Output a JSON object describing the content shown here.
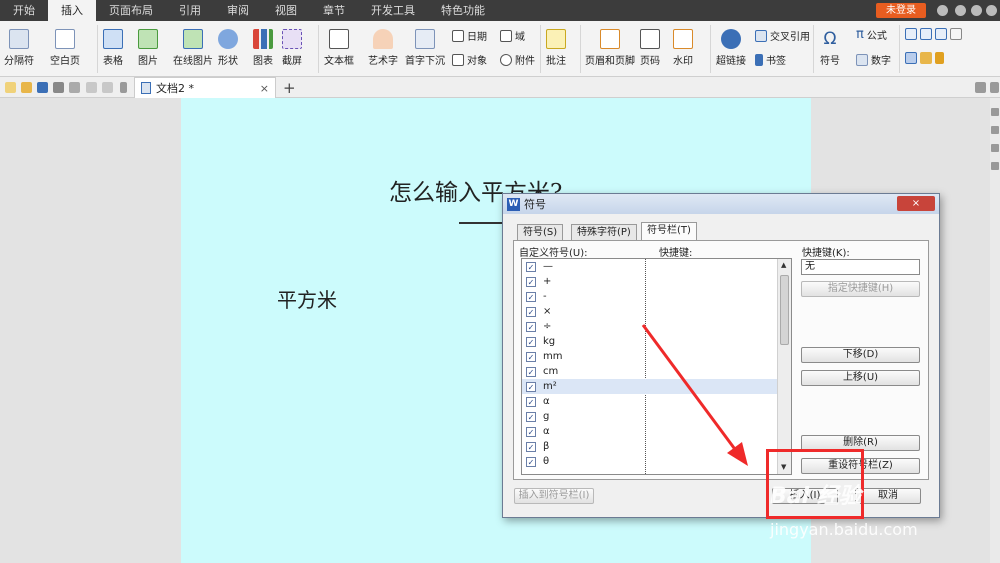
{
  "menubar": {
    "items": [
      "开始",
      "插入",
      "页面布局",
      "引用",
      "审阅",
      "视图",
      "章节",
      "开发工具",
      "特色功能"
    ],
    "active_index": 1,
    "login_label": "未登录"
  },
  "ribbon": {
    "separator_label": "分隔符",
    "blank_page_label": "空白页",
    "table_label": "表格",
    "picture_label": "图片",
    "online_picture_label": "在线图片",
    "shape_label": "形状",
    "chart_label": "图表",
    "screenshot_label": "截屏",
    "textbox_label": "文本框",
    "wordart_label": "艺术字",
    "dropcap_label": "首字下沉",
    "date_label": "日期",
    "field_label": "域",
    "object_label": "对象",
    "attachment_label": "附件",
    "comment_label": "批注",
    "header_footer_label": "页眉和页脚",
    "page_number_label": "页码",
    "watermark_label": "水印",
    "hyperlink_label": "超链接",
    "cross_reference_label": "交叉引用",
    "bookmark_label": "书签",
    "symbol_label": "符号",
    "formula_label": "公式",
    "number_label": "数字"
  },
  "tabbar": {
    "doc_tab_label": "文档2 *",
    "close_glyph": "×",
    "new_tab_glyph": "+"
  },
  "document": {
    "title": "怎么输入平方米?",
    "body": "平方米"
  },
  "dialog": {
    "title": "符号",
    "close_glyph": "×",
    "tabs": [
      "符号(S)",
      "特殊字符(P)",
      "符号栏(T)"
    ],
    "active_tab": 2,
    "custom_symbol_label": "自定义符号(U):",
    "shortcut_col_label": "快捷键:",
    "shortcut_field_label": "快捷键(K):",
    "shortcut_value": "无",
    "symbols": [
      "—",
      "+",
      "-",
      "×",
      "÷",
      "kg",
      "mm",
      "cm",
      "m²",
      "α",
      "g",
      "α",
      "β",
      "θ"
    ],
    "selected_index": 8,
    "check_glyph": "✓",
    "scroll_up_glyph": "▲",
    "scroll_down_glyph": "▼",
    "assign_shortcut_label": "指定快捷键(H)",
    "move_down_label": "下移(D)",
    "move_up_label": "上移(U)",
    "delete_label": "删除(R)",
    "reset_label": "重设符号栏(Z)",
    "insert_to_bar_label": "插入到符号栏(I)",
    "insert_label": "插入(I)",
    "cancel_label": "取消"
  },
  "watermark": {
    "brand": "Bai 经验",
    "url": "jingyan.baidu.com"
  },
  "colors": {
    "menubar_bg": "#3c3c3c",
    "page_bg": "#ccfbfc",
    "accent_orange": "#e85d20",
    "highlight_red": "#ef2a2a"
  }
}
